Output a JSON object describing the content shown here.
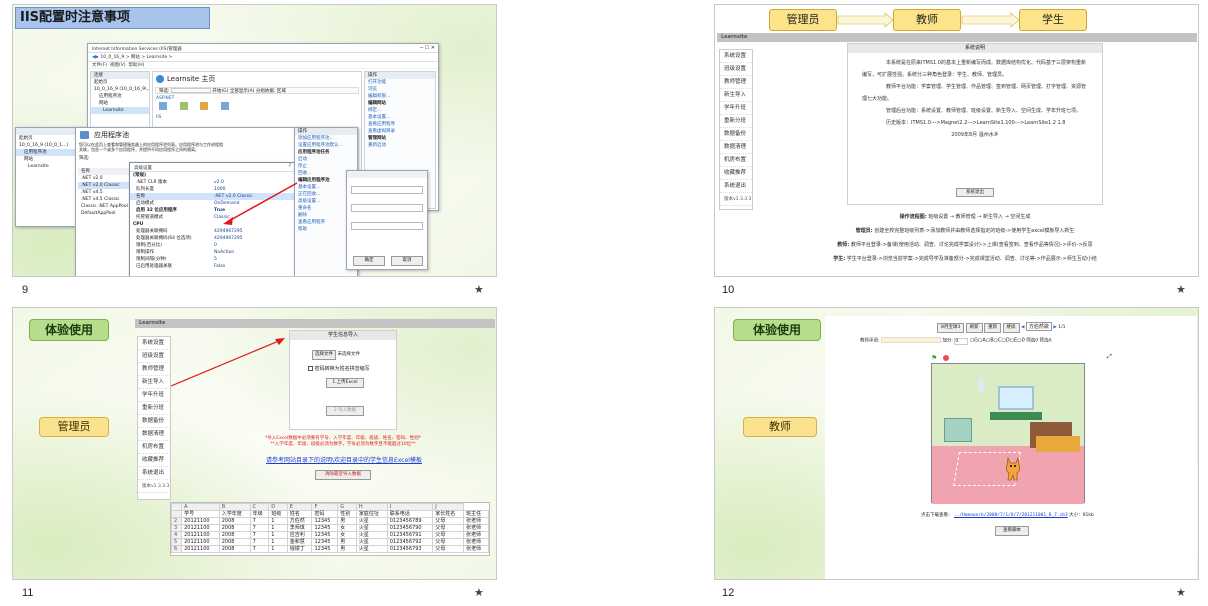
{
  "slides": [
    {
      "number": "9",
      "title": "IIS配置时注意事项",
      "iis": {
        "window_title": "Internet Information Services (IIS)管理器",
        "address": "10_0_16_9 > 网站 > Learnsite >",
        "menu": [
          "文件(F)",
          "视图(V)",
          "帮助(H)"
        ],
        "conn_header": "连接",
        "tree": [
          "起始页",
          "10_0_16_9 (10_0_16_9\\...)",
          "应用程序池",
          "网站",
          "Learnsite"
        ],
        "home_title": "Learnsite 主页",
        "filter": "筛选:",
        "go": "开始(G)",
        "show_all": "全部显示(A)",
        "group_by": "分组依据: 区域",
        "section": "ASP.NET",
        "section2": "IIS",
        "ops_header": "操作",
        "ops": [
          "打开功能",
          "浏览",
          "编辑权限...",
          "编辑网站",
          "绑定...",
          "基本设置...",
          "查看应用程序",
          "查看虚拟目录",
          "管理网站",
          "重新启动"
        ]
      },
      "apppool": {
        "title": "应用程序池",
        "desc": "您可以在此页上查看和管理服务器上的应用程序池列表。应用程序池与工作进程相关联，包含一个或多个应用程序，并提供不同应用程序之间的隔离。",
        "filter": "筛选:",
        "name_header": "名称",
        "items": [
          ".NET v2.0",
          ".NET v2.0 Classic",
          ".NET v4.5",
          ".NET v4.5 Classic",
          "Classic .NET AppPool",
          "DefaultAppPool"
        ],
        "selected_index": 1
      },
      "tree_small": [
        "起始页",
        "10_0_16_9 (10_0_1...)",
        "应用程序池",
        "网站",
        "Learnsite"
      ],
      "advanced": {
        "title": "高级设置",
        "group1": "(常规)",
        "rows": [
          [
            ".NET CLR 版本",
            "v2.0"
          ],
          [
            "队列长度",
            "1000"
          ],
          [
            "名称",
            ".NET v2.0 Classic"
          ],
          [
            "启动模式",
            "OnDemand"
          ],
          [
            "启用 32 位应用程序",
            "True"
          ],
          [
            "托管管道模式",
            "Classic"
          ]
        ],
        "group2": "CPU",
        "rows2": [
          [
            "处理器关联掩码",
            "4294967295"
          ],
          [
            "处理器关联掩码(64 位选项)",
            "4294967295"
          ],
          [
            "限制(百分比)",
            "0"
          ],
          [
            "限制操作",
            "NoAction"
          ],
          [
            "限制间隔(分钟)",
            "5"
          ],
          [
            "已启用处理器关联",
            "False"
          ]
        ],
        "help": "?",
        "close": "✕"
      },
      "pool_ops_header": "操作",
      "pool_ops": [
        "添加应用程序池...",
        "设置应用程序池默认...",
        "应用程序池任务",
        "启动",
        "停止",
        "回收...",
        "编辑应用程序池",
        "基本设置...",
        "正在回收...",
        "高级设置...",
        "重命名",
        "删除",
        "查看应用程序",
        "帮助"
      ],
      "dialog_ok": "确定",
      "dialog_cancel": "取消"
    },
    {
      "number": "10",
      "flow": [
        "管理员",
        "教师",
        "学生"
      ],
      "brand": "Learnsite",
      "menu": [
        "系统设置",
        "班级设置",
        "教师管理",
        "新生导入",
        "学年升班",
        "重新分班",
        "数据备份",
        "数据清理",
        "机房布置",
        "收藏推荐",
        "系统退出"
      ],
      "version": "版本v1.3.3.3",
      "panel_title": "系统说明",
      "paragraphs": [
        "本系统是在原来ITMS1.0的基本上重新编写而成。数据库结构优化、代码基于三层架构重新编写，可扩展性强。系统分三种角色登录：学生、教师、管理员。",
        "教师平台功能：学案管理、学生管理、作品管理、签到管理、网页管理、打字管理、资源管理七大功能。",
        "管理后台功能：系统设置、教师管理、班级设置、新生导入、空间生成、学年升班七项。",
        "历史版本：ITMS1.0--->Magnet2.2--->LearnSite1.100--->LearnSite1.2 1.8",
        "2009年8月 温州水乡"
      ],
      "logout": "系统退出",
      "flows": [
        {
          "label": "操作流程图:",
          "text": "班级设置 → 教师管理 → 新生导入 → 空间生成"
        },
        {
          "label": "管理员:",
          "text": "创建全校完整班级列表->添加教师并由教师选择指定的班级->使用学生excel模板导入新生"
        },
        {
          "label": "教师:",
          "text": "教师平台登录->备课(使用活动、调查、讨论完成学案设计)->上课(查看签到、查看作品等情况)->评价->反思"
        },
        {
          "label": "学生:",
          "text": "学生平台登录->浏览当前学案->完成导学及准备部分->完成课堂活动、调查、讨论等->作品展示->师生互动小结"
        }
      ]
    },
    {
      "number": "11",
      "tag": "体验使用",
      "role": "管理员",
      "brand": "Learnsite",
      "menu": [
        "系统设置",
        "班级设置",
        "教师管理",
        "新生导入",
        "学年升班",
        "重新分班",
        "数据备份",
        "数据清理",
        "机房布置",
        "收藏推荐",
        "系统退出"
      ],
      "version": "版本v1.3.3.3",
      "panel_title": "学生信息导入",
      "choose_file": "选择文件",
      "no_file": "未选择文件",
      "checkbox": "密码转换为姓名拼音缩写",
      "upload": "1.上传Excel",
      "import": "2.导入数据",
      "warn1": "*导入Excel数据中必须要有学号、入学年度、年级、班级、姓名、密码、性别*",
      "warn2": "**入学年度、年级、班级必须为数字，学号必须为数字且不能超过10位**",
      "template_link": "请参考网站目录下的说明\\欢迎目录中的学生信息Excel模板",
      "clear": "清除最近导入数据",
      "col_letters": [
        "A",
        "B",
        "C",
        "D",
        "E",
        "F",
        "G",
        "H",
        "I",
        "J"
      ],
      "table_header": [
        "学号",
        "入学年度",
        "年级",
        "班级",
        "姓名",
        "密码",
        "性别",
        "家庭住址",
        "联系电话",
        "家长姓名",
        "班主任"
      ],
      "rows": [
        [
          "20121100",
          "2008",
          "7",
          "1",
          "方伯然",
          "12345",
          "男",
          "火星",
          "0123456789",
          "父母",
          "张老师"
        ],
        [
          "20121100",
          "2008",
          "7",
          "1",
          "李师琪",
          "12345",
          "女",
          "火星",
          "0123456790",
          "父母",
          "张老师"
        ],
        [
          "20121100",
          "2008",
          "7",
          "1",
          "应吉利",
          "12345",
          "女",
          "火星",
          "0123456791",
          "父母",
          "张老师"
        ],
        [
          "20121100",
          "2008",
          "7",
          "1",
          "金和慧",
          "12345",
          "男",
          "火星",
          "0123456792",
          "父母",
          "张老师"
        ],
        [
          "20121100",
          "2008",
          "7",
          "1",
          "钱镜丁",
          "12345",
          "男",
          "火星",
          "0123456793",
          "父母",
          "张老师"
        ]
      ],
      "row_numbers": [
        "2",
        "3",
        "4",
        "5",
        "6"
      ]
    },
    {
      "number": "12",
      "tag": "体验使用",
      "role": "教师",
      "toolbar": [
        "8月宝球3",
        "刷新",
        "重新",
        "继续"
      ],
      "select": "方伯然歌",
      "page": "1/1",
      "score_label": "教师评语:",
      "grade_label": "加分:",
      "grade_value": "0",
      "options": "○G○A○B○C○D○E○0",
      "check1": "筛选0",
      "check2": "筛选A",
      "download": "点击下载查看：",
      "file_link": "../Homework/2008/7/1/8/7/201211001_8_7.sb3",
      "size": "大小：91kb",
      "view_btn": "查看脚本"
    }
  ],
  "star": "★"
}
